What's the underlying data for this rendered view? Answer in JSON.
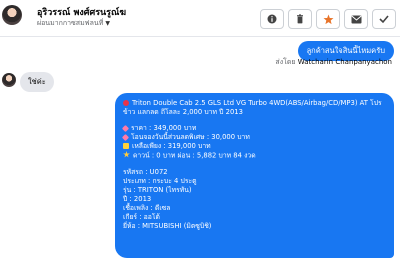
{
  "header": {
    "contact_name": "อุริวรรณ์ พงศ์ศรนรูณ์ฆ",
    "contact_status": "ผ่อนมากกาซสมฟลนที่",
    "actions": [
      "info-icon",
      "delete-icon",
      "star-icon",
      "mail-icon",
      "check-icon"
    ]
  },
  "conversation": {
    "outgoing_short": "ลูกค้าสนใจสินนี้ไหมครับ",
    "sent_by_label": "ส่งโดย",
    "sent_by_name": "Watcharin Chanpanyachon",
    "incoming": "ใช่ค่ะ",
    "listing": {
      "title": "Triton Double Cab 2.5 GLS Ltd VG Turbo 4WD(ABS/Airbag/CD/MP3) AT โปรข้าว แลกลด ถึโลละ 2,000 บาท ปี 2013",
      "price": "ราคา : 349,000 บาท",
      "discount": "โอนจองวันนี้ส่วนลดพิเศษ : 30,000 บาท",
      "remaining": "เหลือเพียง : 319,000 บาท",
      "down_payment": "ดาวน์ : 0 บาท ผ่อน : 5,882 บาท 84 งวด",
      "code": "รหัสรถ : U072",
      "doors": "ประเภท : กระบะ 4 ประตู",
      "model": "รุ่น : TRITON (ไทรทัน)",
      "year": "ปี : 2013",
      "fuel": "เชื้อเพลิง : ดีเซล",
      "gear": "เกียร์ : ออโต้",
      "brand": "ยี่ห้อ : MITSUBISHI (มิตซูบิชิ)"
    }
  },
  "colors": {
    "accent": "#1877f2",
    "incoming_bubble": "#e4e6eb"
  }
}
